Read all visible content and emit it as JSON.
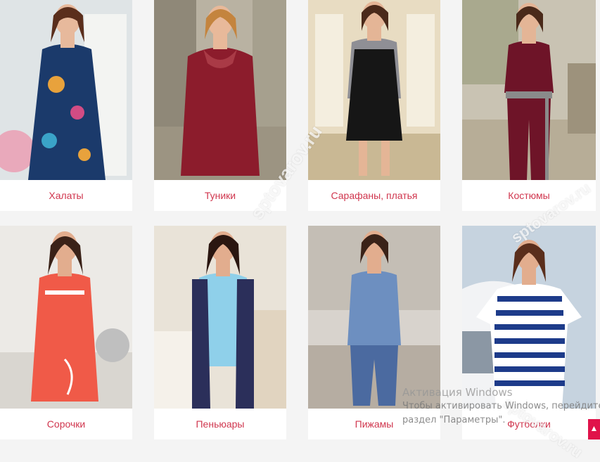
{
  "categories": [
    {
      "label": "Халаты",
      "image": "woman-floral-robe-photo",
      "colors": {
        "bg": "#dfe4e6",
        "garment": "#1b3a6b",
        "accent": "#e8a23c"
      }
    },
    {
      "label": "Туники",
      "image": "woman-red-tunic-photo",
      "colors": {
        "bg": "#b9b2a2",
        "garment": "#8c1c2c",
        "accent": "#a93a46"
      }
    },
    {
      "label": "Сарафаны, платья",
      "image": "woman-black-sundress-photo",
      "colors": {
        "bg": "#e8dcc2",
        "garment": "#161616",
        "accent": "#8f8f95"
      }
    },
    {
      "label": "Костюмы",
      "image": "woman-burgundy-suit-photo",
      "colors": {
        "bg": "#c9c3b3",
        "garment": "#6e1428",
        "accent": "#8a8a8a"
      }
    },
    {
      "label": "Сорочки",
      "image": "woman-coral-nightgown-photo",
      "colors": {
        "bg": "#eceae6",
        "garment": "#f05a48",
        "accent": "#ffffff"
      }
    },
    {
      "label": "Пеньюары",
      "image": "woman-blue-peignoir-photo",
      "colors": {
        "bg": "#e9e3d8",
        "garment": "#8fd0ea",
        "accent": "#2b2f5a"
      }
    },
    {
      "label": "Пижамы",
      "image": "woman-blue-pajamas-photo",
      "colors": {
        "bg": "#d8d3cd",
        "garment": "#6d8fc0",
        "accent": "#4b6aa0"
      }
    },
    {
      "label": "Футболки",
      "image": "woman-striped-tshirt-photo",
      "colors": {
        "bg": "#c6d3df",
        "garment": "#1d3b8a",
        "accent": "#ffffff"
      }
    }
  ],
  "watermark": "sptovarov.ru",
  "activation": {
    "line1": "Активация Windows",
    "line2": "Чтобы активировать Windows, перейдите",
    "line3": "раздел \"Параметры\"."
  },
  "scroll_top_icon": "chevron-up-icon",
  "colors": {
    "label": "#d0364e",
    "page_bg": "#f4f4f4",
    "card_bg": "#ffffff",
    "scroll_top": "#e0134a"
  }
}
